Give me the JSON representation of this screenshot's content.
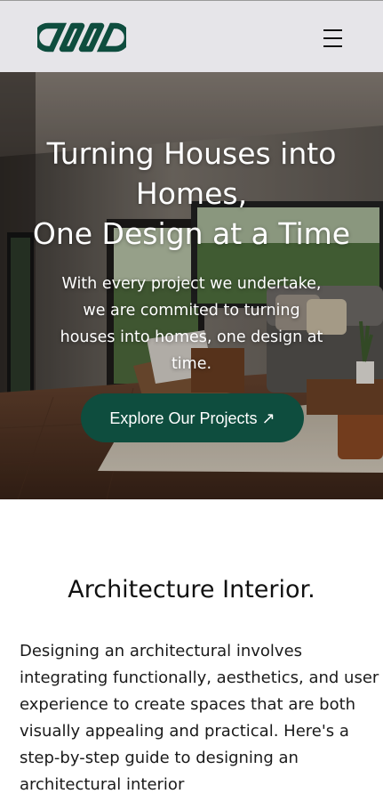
{
  "header": {
    "logo_name": "chain-link-logo",
    "menu_icon": "hamburger-menu-icon"
  },
  "hero": {
    "title_lines": [
      "Turning Houses into",
      "Homes,",
      "One Design at a Time"
    ],
    "subtitle_lines": [
      "With every project we undertake,",
      "we are commited to turning",
      "houses into homes, one design at",
      "time."
    ],
    "cta_label": "Explore Our Projects ↗"
  },
  "section": {
    "title": "Architecture Interior.",
    "body_lines": [
      "Designing an architectural involves",
      "integrating functionally, aesthetics, and user",
      "experience to create spaces that are both",
      "visually appealing and practical. Here's a",
      "step-by-step guide to designing an",
      "architectural interior"
    ]
  },
  "colors": {
    "brand_green": "#0e4d3e",
    "header_bg": "#e6e5e9",
    "text_dark": "#111111"
  }
}
